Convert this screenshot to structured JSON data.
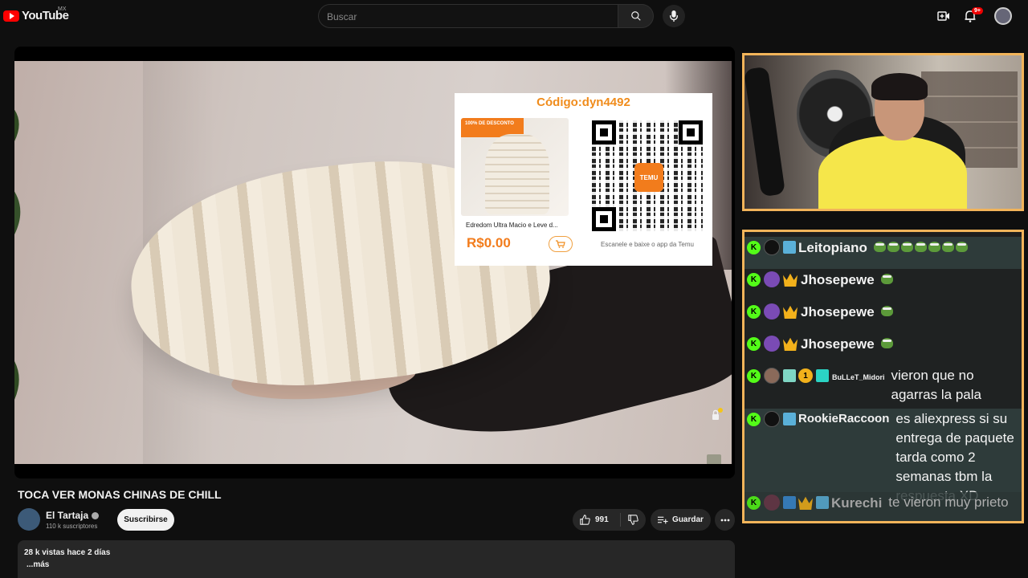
{
  "header": {
    "logo_text": "YouTube",
    "logo_region": "MX",
    "search_placeholder": "Buscar",
    "notifications_badge": "9+"
  },
  "promo": {
    "code": "Código:dyn4492",
    "discount_badge": "100% DE DESCONTO",
    "product_name": "Edredom Ultra Macio e Leve d...",
    "price": "R$0.00",
    "qr_logo": "TEMU",
    "scan_text": "Escanele e baixe o app da Temu"
  },
  "chat": {
    "messages": [
      {
        "user": "Leitopiano",
        "text": ""
      },
      {
        "user": "Jhosepewe",
        "text": ""
      },
      {
        "user": "Jhosepewe",
        "text": ""
      },
      {
        "user": "Jhosepewe",
        "text": ""
      },
      {
        "user": "BuLLeT_Midori",
        "text": "vieron que no agarras la pala",
        "badge_text": "1"
      },
      {
        "user": "RookieRaccoon",
        "text": "es aliexpress si su entrega de paquete tarda como 2 semanas tbm la respuesta XD"
      },
      {
        "user": "Kurechi",
        "text": "te vieron muy prieto"
      }
    ]
  },
  "video": {
    "title": "TOCA VER MONAS CHINAS DE CHILL",
    "channel_name": "El Tartaja",
    "subscribers": "110 k suscriptores",
    "subscribe_label": "Suscribirse",
    "likes": "991",
    "save_label": "Guardar",
    "views_date": "28 k vistas  hace 2 días",
    "more_label": "...más"
  },
  "colors": {
    "accent_red": "#ff0000",
    "overlay_border": "#f2b45a",
    "kick_green": "#53fc18",
    "temu_orange": "#f27c1c"
  }
}
